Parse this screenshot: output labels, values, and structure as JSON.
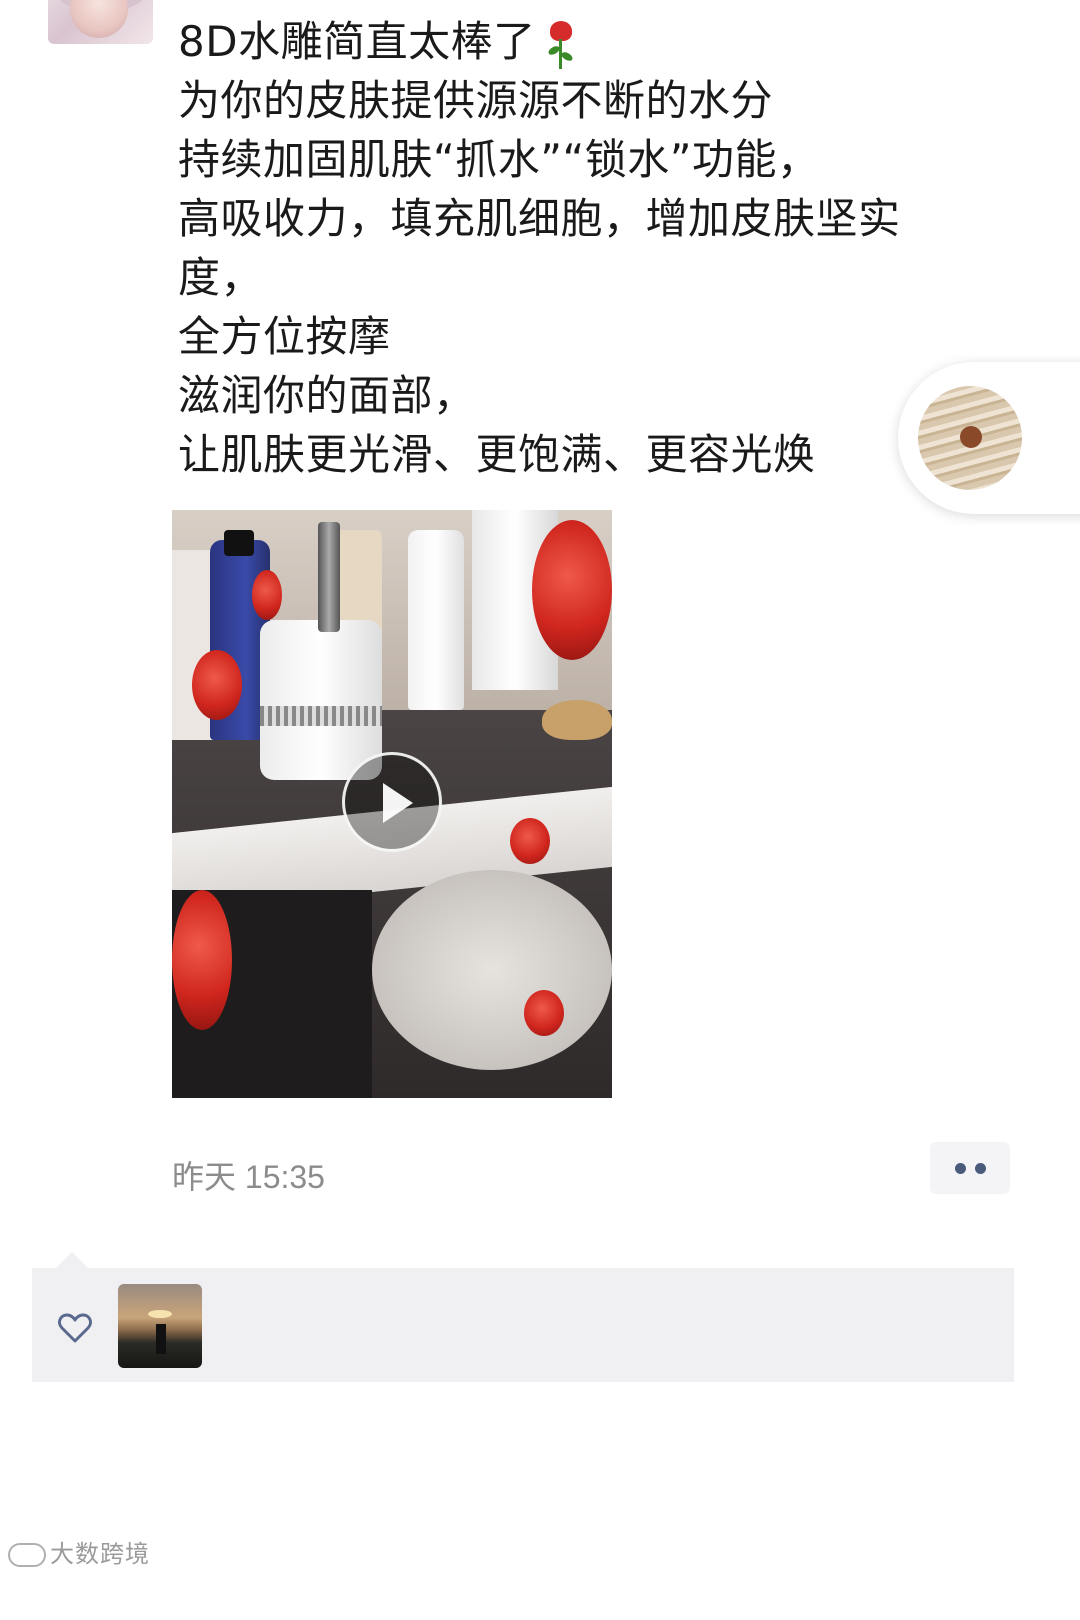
{
  "post": {
    "lines": [
      "8D水雕简直太棒了",
      "为你的皮肤提供源源不断的水分",
      "持续加固肌肤“抓水”“锁水”功能，",
      "高吸收力，填充肌细胞，增加皮肤坚实",
      "度，",
      "全方位按摩",
      "滋润你的面部，",
      "让肌肤更光滑、更饱满、更容光焕"
    ],
    "title_emoji": "rose-emoji",
    "timestamp": "昨天 15:35"
  },
  "video": {
    "icon": "play-icon"
  },
  "likes": {
    "icon": "heart-icon"
  },
  "watermark": {
    "text": "大数跨境"
  },
  "colors": {
    "text": "#1a1a1a",
    "timestamp": "#8c8c8c",
    "more_dots": "#4a5a7a",
    "likes_bg": "#f0f0f2"
  }
}
